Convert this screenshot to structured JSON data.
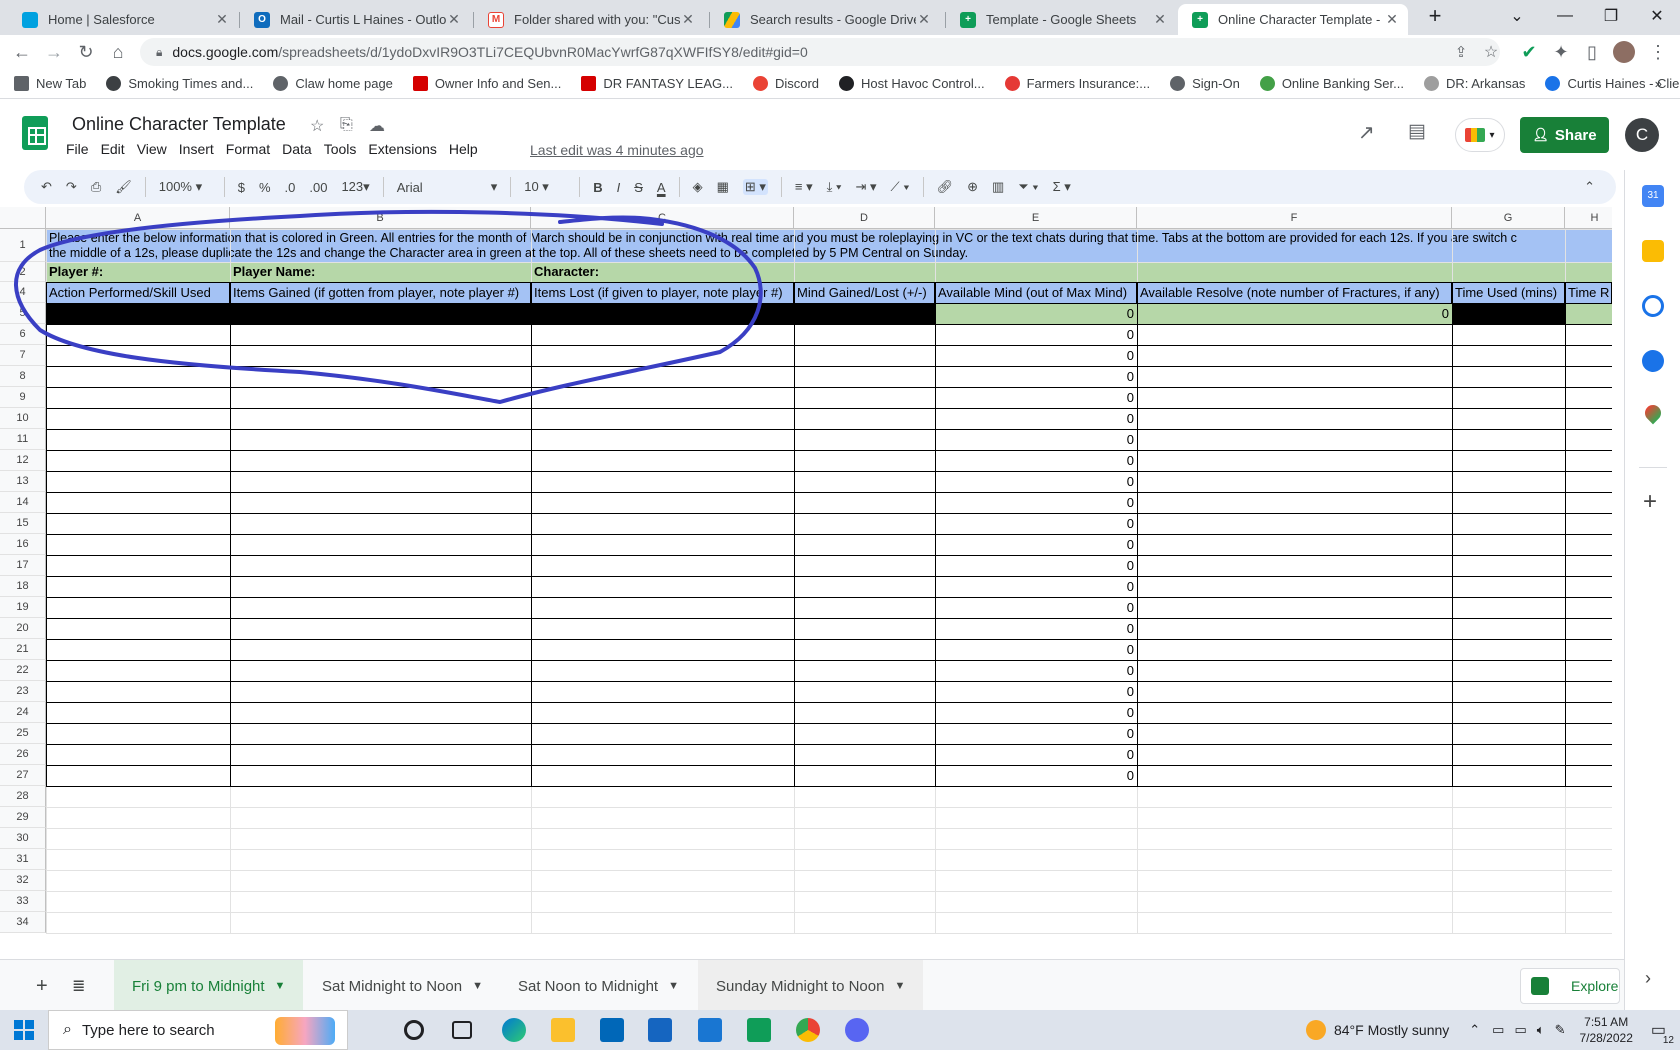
{
  "browser": {
    "tabs": [
      {
        "title": "Home | Salesforce",
        "color": "#00a1e0"
      },
      {
        "title": "Mail - Curtis L Haines - Outlook",
        "color": "#0f6cbd"
      },
      {
        "title": "Folder shared with you: \"Custom",
        "color": "#ea4335"
      },
      {
        "title": "Search results - Google Drive",
        "color": "#fbbc04"
      },
      {
        "title": "Template - Google Sheets",
        "color": "#0f9d58"
      },
      {
        "title": "Online Character Template - Go",
        "color": "#0f9d58"
      }
    ],
    "url_host": "docs.google.com",
    "url_path": "/spreadsheets/d/1ydoDxvIR9O3TLi7CEQUbvnR0MacYwrfG87qXWFIfSY8/edit#gid=0",
    "bookmarks": [
      "New Tab",
      "Smoking Times and...",
      "Claw home page",
      "Owner Info and Sen...",
      "DR FANTASY LEAG...",
      "Discord",
      "Host Havoc Control...",
      "Farmers Insurance:...",
      "Sign-On",
      "Online Banking Ser...",
      "DR: Arkansas",
      "Curtis Haines - Clie..."
    ],
    "bookmark_colors": [
      "#5f6368",
      "#3c4043",
      "#5f6368",
      "#d50000",
      "#d50000",
      "#ea4335",
      "#202124",
      "#e53935",
      "#5f6368",
      "#43a047",
      "#9e9e9e",
      "#1a73e8"
    ]
  },
  "sheets": {
    "title": "Online Character Template",
    "menu": [
      "File",
      "Edit",
      "View",
      "Insert",
      "Format",
      "Data",
      "Tools",
      "Extensions",
      "Help"
    ],
    "last_edit": "Last edit was 4 minutes ago",
    "share_label": "Share",
    "avatar_letter": "C",
    "toolbar": {
      "zoom": "100%",
      "currency": "$",
      "percent": "%",
      "dec_less": ".0",
      "dec_more": ".00",
      "format_more": "123",
      "font": "Arial",
      "font_size": "10",
      "bold": "B",
      "italic": "I",
      "strike": "S",
      "text_color": "A"
    },
    "columns": [
      "A",
      "B",
      "C",
      "D",
      "E",
      "F",
      "G",
      "H"
    ],
    "row1_text_a": "Please enter the below information that is colored in Green. All entries for the month of March should be in conjunction with real time and you must be roleplaying in VC or the text chats during that time. Tabs at the bottom are provided for each 12s. If you are switch c",
    "row1_text_b": "the middle of a 12s, please duplicate the 12s and change the Character area in green at the top. All of these sheets need to be completed by 5 PM Central on Sunday.",
    "row2": {
      "player_num": "Player #:",
      "player_name": "Player Name:",
      "character": "Character:"
    },
    "headers": [
      "Action Performed/Skill Used",
      "Items Gained (if gotten from player, note player #)",
      "Items Lost (if given to player, note player #)",
      "Mind Gained/Lost (+/-)",
      "Available Mind (out of Max Mind)",
      "Available Resolve (note number of Fractures, if any)",
      "Time Used (mins)",
      "Time R"
    ],
    "row4": {
      "e": "0",
      "f": "0"
    },
    "zero_value": "0",
    "row_numbers": [
      "1",
      "2",
      "4",
      "5",
      "6",
      "7",
      "8",
      "9",
      "10",
      "11",
      "12",
      "13",
      "14",
      "15",
      "16",
      "17",
      "18",
      "19",
      "20",
      "21",
      "22",
      "23",
      "24",
      "25",
      "26",
      "27",
      "28",
      "29",
      "30",
      "31",
      "32",
      "33",
      "34"
    ],
    "sheet_tabs": [
      "Fri 9 pm to Midnight",
      "Sat Midnight to Noon",
      "Sat Noon to Midnight",
      "Sunday Midnight to Noon"
    ],
    "explore_label": "Explore",
    "colors": {
      "blue_row": "#a4c2f4",
      "green_cell": "#b6d7a8",
      "black_cell": "#000000",
      "accent": "#188038"
    }
  },
  "taskbar": {
    "search_placeholder": "Type here to search",
    "weather": "84°F  Mostly sunny",
    "time": "7:51 AM",
    "date": "7/28/2022",
    "notifications": "12"
  }
}
